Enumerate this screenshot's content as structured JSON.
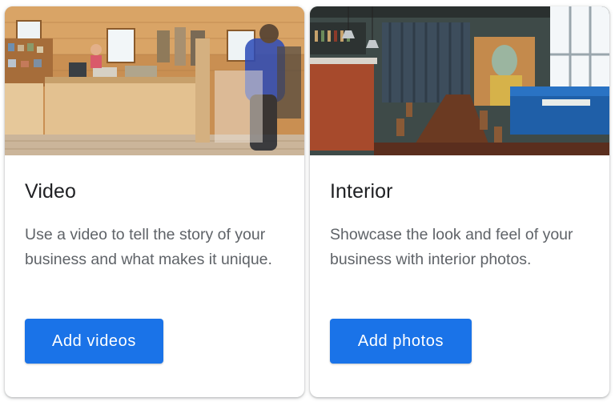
{
  "cards": [
    {
      "title": "Video",
      "description": "Use a video to tell the story of your business and what makes it unique.",
      "button_label": "Add videos",
      "image": "shop-interior-photo"
    },
    {
      "title": "Interior",
      "description": "Showcase the look and feel of your business with interior photos.",
      "button_label": "Add photos",
      "image": "restaurant-interior-photo"
    }
  ],
  "colors": {
    "primary_button": "#1a73e8",
    "title_text": "#202124",
    "body_text": "#5f6368"
  }
}
